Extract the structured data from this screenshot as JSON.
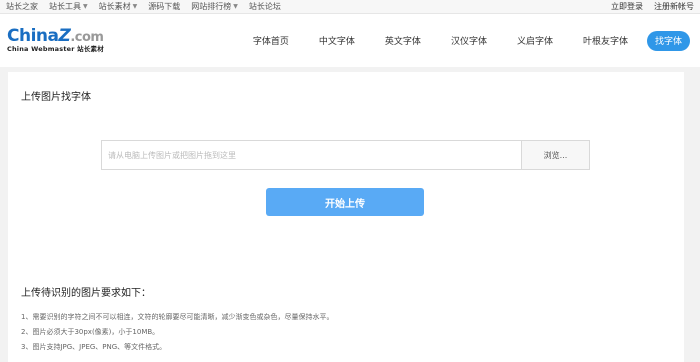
{
  "topbar": {
    "left_links": [
      {
        "label": "站长之家",
        "dropdown": false
      },
      {
        "label": "站长工具",
        "dropdown": true
      },
      {
        "label": "站长素材",
        "dropdown": true
      },
      {
        "label": "源码下载",
        "dropdown": false
      },
      {
        "label": "网站排行榜",
        "dropdown": true
      },
      {
        "label": "站长论坛",
        "dropdown": false
      }
    ],
    "login": "立即登录",
    "register": "注册新帐号"
  },
  "logo": {
    "main_prefix": "China",
    "main_z": "Z",
    "main_suffix": ".com",
    "sub": "China Webmaster 站长素材"
  },
  "nav": {
    "items": [
      "字体首页",
      "中文字体",
      "英文字体",
      "汉仪字体",
      "义启字体",
      "叶根友字体"
    ],
    "active": "找字体"
  },
  "upload": {
    "section_title": "上传图片找字体",
    "placeholder": "请从电脑上传图片或把图片拖到这里",
    "browse_label": "浏览...",
    "start_label": "开始上传"
  },
  "requirements": {
    "title": "上传待识别的图片要求如下：",
    "items": [
      "1、需要识别的字符之间不可以相连，文符的轮廓要尽可能清晰，减少渐变色或杂色，尽量保持水平。",
      "2、图片必须大于30px(像素)，小于10MB。",
      "3、图片支持JPG、JPEG、PNG、等文件格式。"
    ]
  },
  "colors": {
    "brand_blue": "#1a6ec2",
    "active_nav": "#2f97e8",
    "start_button": "#59aaf5"
  }
}
